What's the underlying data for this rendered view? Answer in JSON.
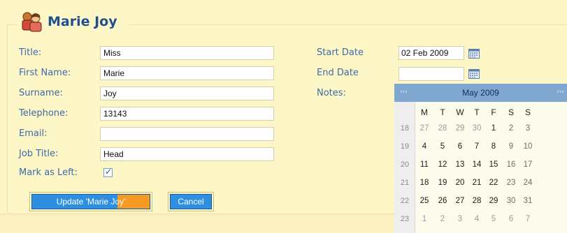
{
  "header": {
    "title": "Marie Joy",
    "icon": "users-icon"
  },
  "form": {
    "title_label": "Title:",
    "title_value": "Miss",
    "firstname_label": "First Name:",
    "firstname_value": "Marie",
    "surname_label": "Surname:",
    "surname_value": "Joy",
    "telephone_label": "Telephone:",
    "telephone_value": "13143",
    "email_label": "Email:",
    "email_value": "",
    "jobtitle_label": "Job Title:",
    "jobtitle_value": "Head",
    "left_label": "Mark as Left:",
    "left_checked": true,
    "startdate_label": "Start Date",
    "startdate_value": "02 Feb 2009",
    "enddate_label": "End Date",
    "enddate_value": "",
    "notes_label": "Notes:"
  },
  "buttons": {
    "update_label": "Update 'Marie Joy'",
    "cancel_label": "Cancel"
  },
  "calendar": {
    "month_title": "May 2009",
    "prev": "‹‹‹",
    "next": "›››",
    "weekdays": [
      "M",
      "T",
      "W",
      "T",
      "F",
      "S",
      "S"
    ],
    "weeks": [
      {
        "wk": "18",
        "days": [
          "27",
          "28",
          "29",
          "30",
          "1",
          "2",
          "3"
        ]
      },
      {
        "wk": "19",
        "days": [
          "4",
          "5",
          "6",
          "7",
          "8",
          "9",
          "10"
        ]
      },
      {
        "wk": "20",
        "days": [
          "11",
          "12",
          "13",
          "14",
          "15",
          "16",
          "17"
        ]
      },
      {
        "wk": "21",
        "days": [
          "18",
          "19",
          "20",
          "21",
          "22",
          "23",
          "24"
        ]
      },
      {
        "wk": "22",
        "days": [
          "25",
          "26",
          "27",
          "28",
          "29",
          "30",
          "31"
        ]
      },
      {
        "wk": "23",
        "days": [
          "1",
          "2",
          "3",
          "4",
          "5",
          "6",
          "7"
        ]
      }
    ]
  },
  "colors": {
    "panel": "#fdf6c6",
    "label": "#3e6aa8",
    "title": "#1f4f8f",
    "button": "#2e8fe0",
    "calendar_header": "#7fa7cf"
  }
}
